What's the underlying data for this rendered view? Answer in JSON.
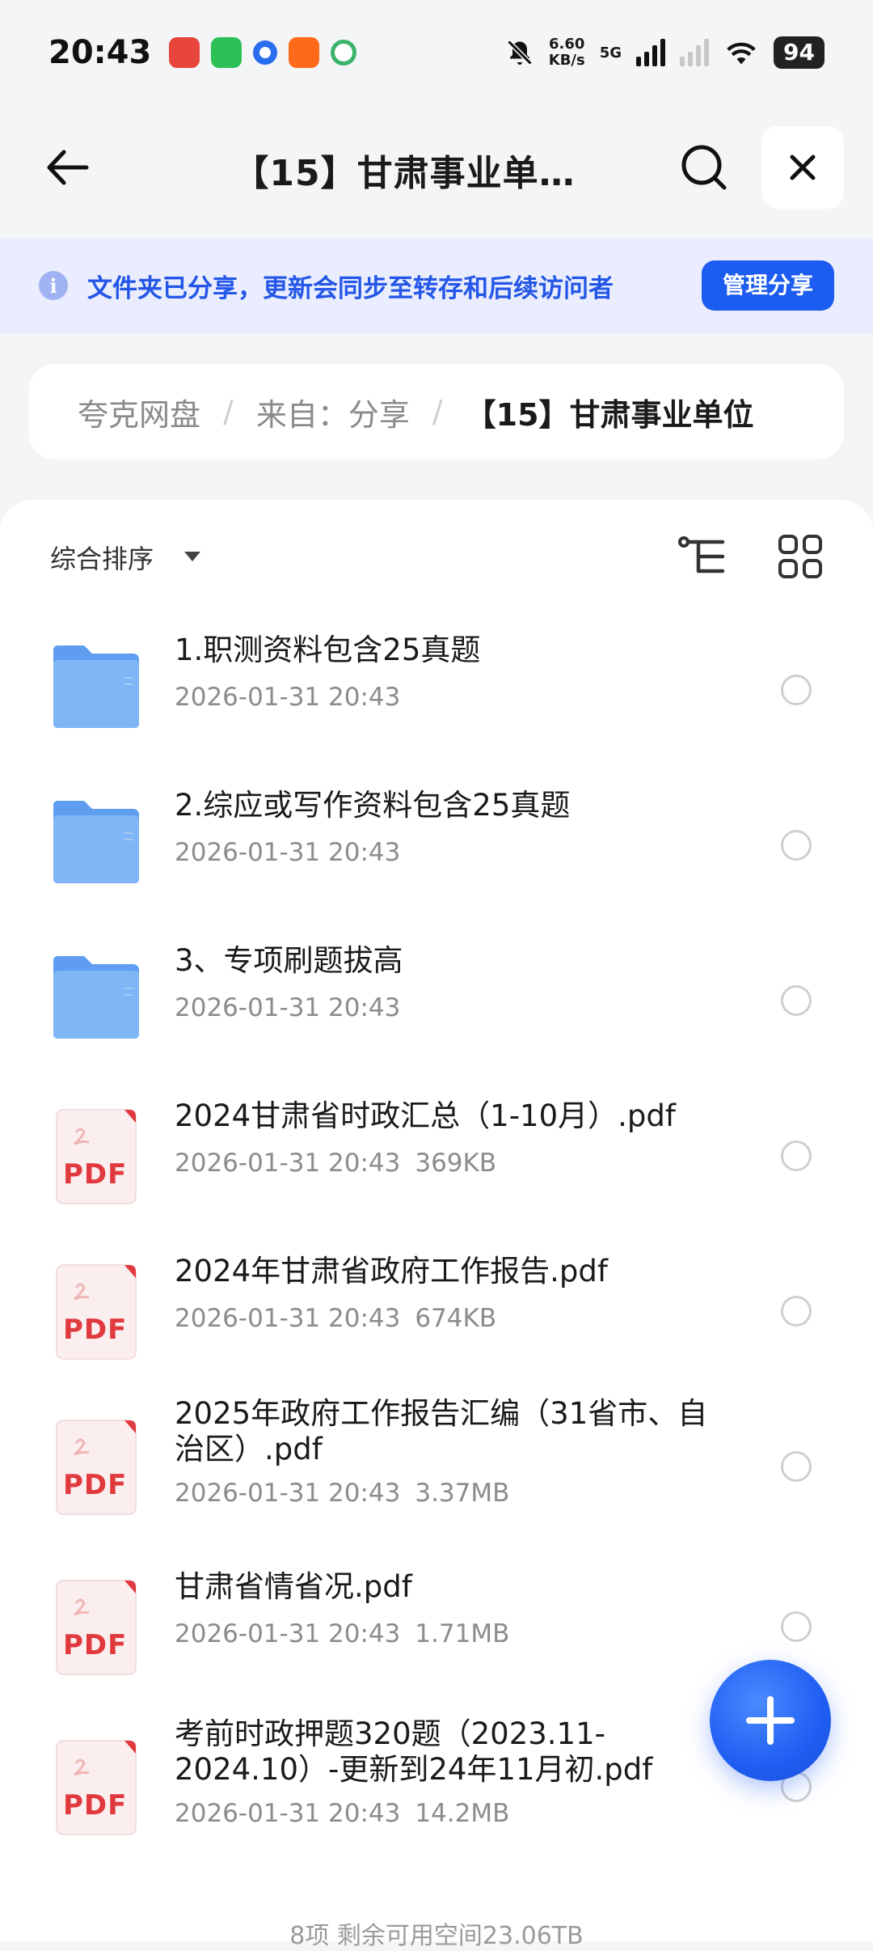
{
  "status_bar": {
    "time": "20:43",
    "speed_value": "6.60",
    "speed_unit": "KB/s",
    "network": "5G",
    "battery": "94"
  },
  "header": {
    "title": "【15】甘肃事业单…"
  },
  "notice": {
    "info_glyph": "i",
    "text": "文件夹已分享，更新会同步至转存和后续访问者",
    "action_label": "管理分享"
  },
  "breadcrumb": {
    "items": [
      "夸克网盘",
      "来自：分享"
    ],
    "separator": "/",
    "current": "【15】甘肃事业单位"
  },
  "toolbar": {
    "sort_label": "综合排序"
  },
  "files": [
    {
      "type": "folder",
      "name": "1.职测资料包含25真题",
      "date": "2026-01-31 20:43",
      "size": ""
    },
    {
      "type": "folder",
      "name": "2.综应或写作资料包含25真题",
      "date": "2026-01-31 20:43",
      "size": ""
    },
    {
      "type": "folder",
      "name": "3、专项刷题拔高",
      "date": "2026-01-31 20:43",
      "size": ""
    },
    {
      "type": "pdf",
      "name": "2024甘肃省时政汇总（1-10月）.pdf",
      "date": "2026-01-31 20:43",
      "size": "369KB"
    },
    {
      "type": "pdf",
      "name": "2024年甘肃省政府工作报告.pdf",
      "date": "2026-01-31 20:43",
      "size": "674KB"
    },
    {
      "type": "pdf",
      "name": "2025年政府工作报告汇编（31省市、自治区）.pdf",
      "date": "2026-01-31 20:43",
      "size": "3.37MB"
    },
    {
      "type": "pdf",
      "name": "甘肃省情省况.pdf",
      "date": "2026-01-31 20:43",
      "size": "1.71MB"
    },
    {
      "type": "pdf",
      "name": "考前时政押题320题（2023.11-2024.10）-更新到24年11月初.pdf",
      "date": "2026-01-31 20:43",
      "size": "14.2MB"
    }
  ],
  "pdf_label": "PDF",
  "footer": {
    "summary": "8项 剩余可用空间23.06TB"
  },
  "colors": {
    "accent": "#1d5cf0",
    "banner_bg": "#e9edfd",
    "folder": "#7fb6f5",
    "pdf_red": "#e0393e"
  }
}
